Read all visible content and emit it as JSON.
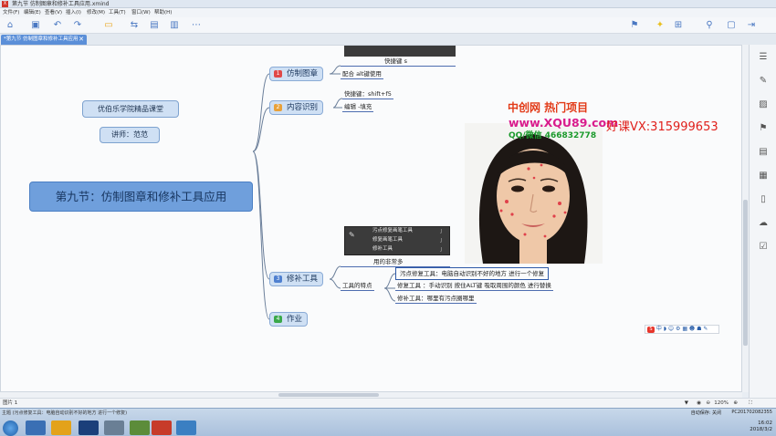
{
  "window": {
    "title": "第九节 仿制图章和修补工具应用.xmind",
    "app_badge": "X"
  },
  "menu": [
    "文件(F)",
    "编辑(E)",
    "查看(V)",
    "插入(I)",
    "修改(M)",
    "工具(T)",
    "窗口(W)",
    "帮助(H)"
  ],
  "tab": {
    "label": "*第九节 仿制图章和修补工具应用",
    "close": "✕"
  },
  "map": {
    "floating1": "优伯乐学院精品课堂",
    "floating2": "讲师：范范",
    "central": "第九节：仿制图章和修补工具应用",
    "branches": [
      {
        "num": "1",
        "label": "仿制图章",
        "color": "#e04848"
      },
      {
        "num": "2",
        "label": "内容识别",
        "color": "#e8a13a"
      },
      {
        "num": "3",
        "label": "修补工具",
        "color": "#4f80d0"
      },
      {
        "num": "4",
        "label": "作业",
        "color": "#3aa84a"
      }
    ],
    "b1_subs": [
      "快捷键  s",
      "配合 alt键使用"
    ],
    "b2_subs": [
      "快捷键：shift+f5",
      "编辑 -填充"
    ],
    "b3_note": "用的非常多",
    "b3_group": "工具的特点",
    "b3_items": [
      "污点修复工具：电脑自动识别不好的地方  进行一个修复",
      "修复工具 ：手动识别  按住ALT键  吸取周围的颜色  进行替换",
      "修补工具：哪里有污点圈哪里"
    ]
  },
  "ps_panel": {
    "rows": [
      {
        "label": "污点修复画笔工具",
        "key": "J"
      },
      {
        "label": "修复画笔工具",
        "key": "J"
      },
      {
        "label": "修补工具",
        "key": "J"
      }
    ]
  },
  "watermark": {
    "title": "中创网 热门项目",
    "url": "www.XQU89.com",
    "contact": "QQ/微信 466832778",
    "vx": "好课VX:315999653"
  },
  "im_bar": {
    "logo": "S",
    "text": "中 ◗ ☺ ⚙ ▦ ☻ ☗ ✎"
  },
  "statusbar": {
    "left": "图片 1",
    "zoom": "120%"
  },
  "taskbar": {
    "status_text": "主题 (污点修复工具：电脑自动识别不好的地方 进行一个修复)",
    "autosave": "自动保存: 关闭",
    "pc": "PC201702082355",
    "time": "16:02",
    "date": "2018/3/2"
  }
}
